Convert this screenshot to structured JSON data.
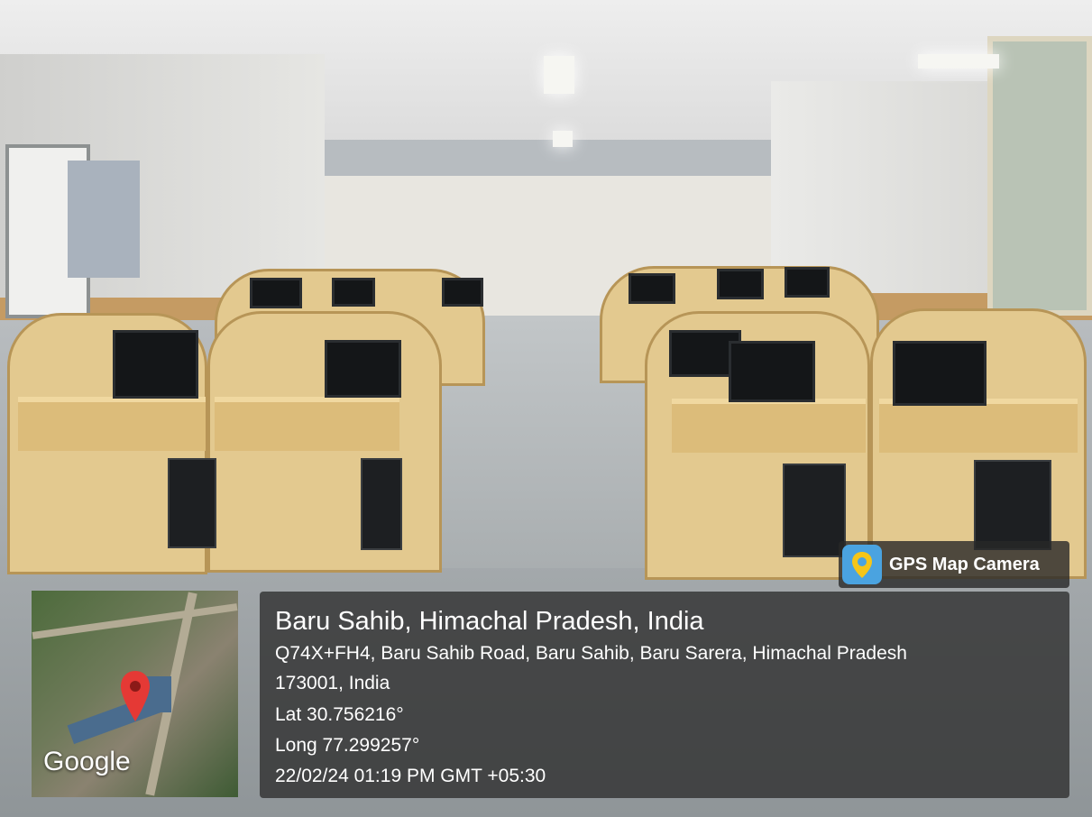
{
  "overlay": {
    "app_badge": "GPS Map Camera",
    "map_logo": "Google",
    "location_title": "Baru Sahib, Himachal Pradesh, India",
    "address_line1": "Q74X+FH4, Baru Sahib Road, Baru Sahib, Baru Sarera, Himachal Pradesh",
    "address_line2": "173001, India",
    "latitude": "Lat 30.756216°",
    "longitude": "Long 77.299257°",
    "timestamp": "22/02/24 01:19 PM GMT +05:30"
  },
  "icons": {
    "badge_icon": "map-camera-pin-icon",
    "map_pin": "location-pin-icon"
  },
  "colors": {
    "pin": "#e53935",
    "badge_icon": "#4aa3e0",
    "desk_wood": "#e3c98f"
  }
}
